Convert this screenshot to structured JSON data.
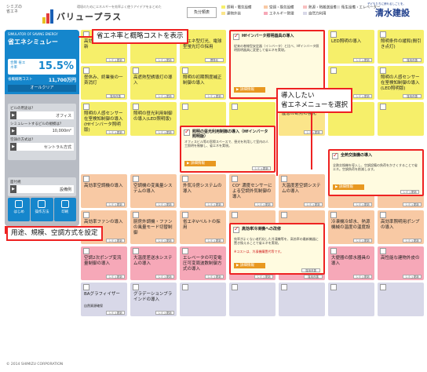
{
  "header": {
    "logo_small": "シミズの",
    "logo_small2": "省エネ",
    "logo_title": "バリュープラス",
    "logo_sub": "環境のためにエネルギーを効率よく使うアイデアをまとめた",
    "legend_label": "負分類表",
    "legend": [
      {
        "label": "照明・電気設備",
        "color": "#f6ef6a"
      },
      {
        "label": "建物外装",
        "color": "#fbe58a"
      },
      {
        "label": "空調・換気設備",
        "color": "#f8c9a4"
      },
      {
        "label": "エネルギー管理",
        "color": "#f6a8b8"
      },
      {
        "label": "熱源・熱搬送設備",
        "color": "#f8c0c0"
      },
      {
        "label": "自然力利用",
        "color": "#d8d8e8"
      },
      {
        "label": "衛生設備・エレベーター",
        "color": "#e0e0e0"
      }
    ],
    "brand_sub": "子どもたちに誇れるしごとを。",
    "brand": "清水建設"
  },
  "sidebar": {
    "sim_en": "SIMULATOR OF SAVING ENERGY",
    "sim_jp": "省エネシミュレー",
    "sim_btn": "説明",
    "rate_label": "合算 省エネ率",
    "rate_value": "15.5%",
    "cost_label": "省概概略コスト",
    "cost_value": "11,700万円",
    "clear": "オールクリア",
    "q1": "ビルの用途は？",
    "a1": "オフィス",
    "q2": "シミュレートするビルの規模は？",
    "a2": "10,000m²",
    "q3": "空調の方式は？",
    "a3": "セントラル方式",
    "q4": "面付規",
    "a4": "設備例",
    "nav": [
      "はじめ",
      "操作方法",
      "印刷"
    ]
  },
  "tiles": [
    {
      "label": "高効率変圧器への更新",
      "sm": "シミュ更新"
    },
    {
      "label": "照明器具の高効率化",
      "sm": "シミュ更新"
    },
    {
      "label": "省エネ型灯光、電球型蛍光灯の採用",
      "sm": "標準化"
    },
    {
      "label": "",
      "sm": "シミュ更新"
    },
    {
      "label": "",
      "sm": ""
    },
    {
      "label": "LED照明の導入",
      "sm": "シミュ更新"
    },
    {
      "label": "照明条件の緩和(間引き点灯)",
      "sm": "運用改善"
    },
    {
      "label": "昼休み、終業後の一斉消灯",
      "sm": "運用改善"
    },
    {
      "label": "高遮熱型誘導灯の導入",
      "sm": "シミュ更新"
    },
    {
      "label": "照明の初期照度補正制御の導入",
      "sm": "シミュ更新"
    },
    {
      "label": "人感センサー・在席連動照明",
      "sm": ""
    },
    {
      "label": "",
      "sm": ""
    },
    {
      "label": "",
      "sm": "シミュ更新"
    },
    {
      "label": "照明の人感センサー在室検知制御の導入(LED照明版)",
      "sm": "運用改善"
    },
    {
      "label": "照明の人感センサー在室検知制御の導入(Hfインバータ照明版)",
      "sm": "シミュ更新"
    },
    {
      "label": "照明の昼光利用制御の導入(LED照明版)",
      "sm": "シミュ更新"
    },
    {
      "label": "",
      "sm": ""
    },
    {
      "label": "屋窓の断熱の強化",
      "sm": "シミュ更新"
    },
    {
      "label": "",
      "sm": ""
    },
    {
      "label": "高効率空調機の導入",
      "sm": "シミュ更新"
    },
    {
      "label": "空調機の変風量システムの導入",
      "sm": "シミュ更新"
    },
    {
      "label": "外気冷房システムの導入",
      "sm": "シミュ更新"
    },
    {
      "label": "CO² 濃度センサーによる空調外気制御の導入",
      "sm": "シミュ更新"
    },
    {
      "label": "大温度差空調システムの導入",
      "sm": "シミュ更新"
    },
    {
      "label": "床吹出空調システムの導入",
      "sm": "シミュ更新"
    },
    {
      "label": "放射冷暖房空調システムの導入",
      "sm": "シミュ更新"
    },
    {
      "label": "高効率ファンの導入",
      "sm": "シミュ更新"
    },
    {
      "label": "厨房外調機・ファンの風量モード切替制御",
      "sm": "シミュ更新"
    },
    {
      "label": "省エネVベルトの採用",
      "sm": "シミュ更新"
    },
    {
      "label": "",
      "sm": ""
    },
    {
      "label": "冷凍機冷却水、熱源機械の温度の温度設",
      "sm": "シミュ更新"
    },
    {
      "label": "高効率照明用ポンプの導入",
      "sm": "シミュ更新"
    },
    {
      "label": "空調2次ポンプ変流量制御の導入",
      "sm": "シミュ更新"
    },
    {
      "label": "大温度差送水システムの導入",
      "sm": "シミュ更新"
    },
    {
      "label": "エレベータの可変電圧可変周波数制御方式の導入",
      "sm": "シミュ更新"
    },
    {
      "label": "エレベータの電力回生制御の導入",
      "sm": "シミュ更新"
    },
    {
      "label": "便所洗浄用の給湯中止／給湯期間の短縮",
      "sm": "運用改善"
    },
    {
      "label": "大便器の節水器具の導入",
      "sm": "シミュ更新"
    },
    {
      "label": "高性能な建物外皮の",
      "sm": "シミュ更新"
    },
    {
      "label": "BAグラフィイザー",
      "sub": "自然資源確保",
      "sm": "シミュ更新"
    },
    {
      "label": "グラデーションブラインドの導入",
      "sm": "シミュ更新"
    }
  ],
  "big_tiles": [
    {
      "label": "Hfインバータ照明器具の導入",
      "desc": "従来の巻線型安定器（インバータ）と比べ、Hfインバータ照明照明器具に変更して省エネを実現。",
      "detail": "詳細情報",
      "sm": "標準改善"
    },
    {
      "label": "照明の昼光利用制御の導入（Hfインバータ照明版）",
      "desc": "オフィスビル等の窓際スペースで、昼光を利用して室内の人工照明を制御し、省エネを実現。",
      "detail": "詳細情報",
      "sm": "シミュ更新"
    },
    {
      "label": "全熱交換機の導入",
      "desc": "全熱交換機を導入し、空調設備の負荷をかさくすることで省エネ。空調負荷を削減します。",
      "detail": "詳細情報",
      "sm": "シミュ更新"
    },
    {
      "label": "高効率冷凍機への改修",
      "desc": "効率がよくない老朽化した冷凍機等を、高効率の最新機器に置き換えることで省エネを実現。",
      "desc2": "※コストは、冷凍機購置代等です。",
      "detail": "詳細情報",
      "sm": "運用改善"
    }
  ],
  "callouts": {
    "top": "省エネ率と概略コストを表示",
    "middle": "導入したい\n省エネメニューを選択",
    "bottom": "用途、規模、空調方式を設定"
  },
  "footer": "© 2014 SHIMIZU CORPORATION"
}
